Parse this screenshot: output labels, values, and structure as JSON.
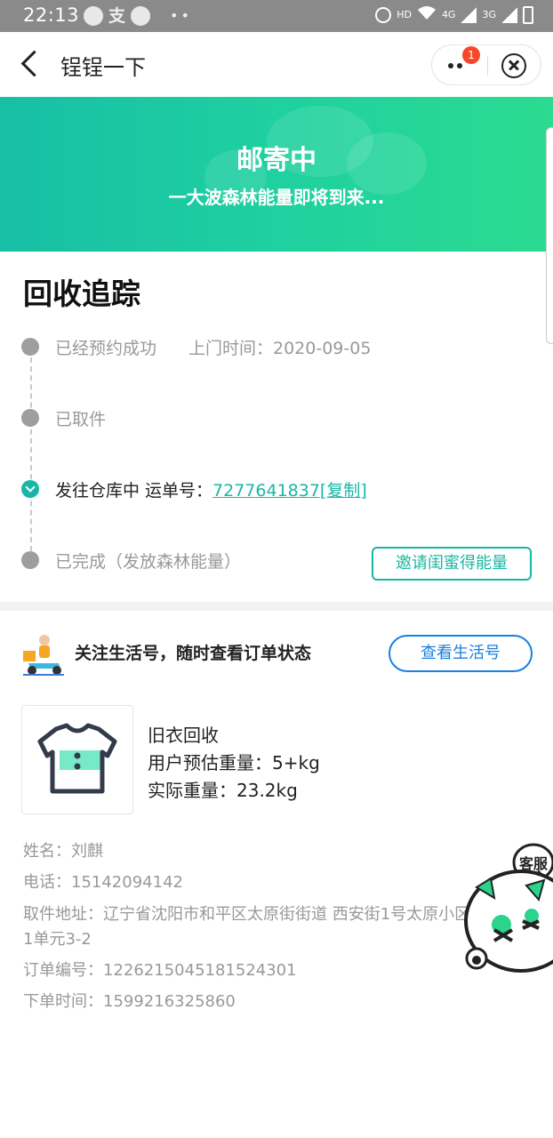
{
  "status_bar": {
    "time": "22:13",
    "app_icon_zhi": "支",
    "network": "HD",
    "sig1": "4G",
    "sig2": "3G"
  },
  "titlebar": {
    "title": "锃锃一下",
    "notification_count": "1",
    "icons": [
      "back-arrow-icon",
      "more-dots-icon",
      "close-circle-icon"
    ]
  },
  "banner": {
    "title": "邮寄中",
    "subtitle": "一大波森林能量即将到来..."
  },
  "tracking": {
    "title": "回收追踪",
    "steps": [
      {
        "label": "已经预约成功",
        "time": "上门时间：2020-09-05",
        "status": "done"
      },
      {
        "label": "已取件",
        "status": "done"
      },
      {
        "label": "发往仓库中 运单号：",
        "tracking_no": "7277641837[复制]",
        "status": "current"
      },
      {
        "label": "已完成（发放森林能量）",
        "status": "pending"
      }
    ],
    "invite_button": "邀请闺蜜得能量"
  },
  "follow": {
    "text": "关注生活号，随时查看订单状态",
    "button": "查看生活号"
  },
  "product": {
    "name": "旧衣回收",
    "estimate": "用户预估重量：5+kg",
    "actual": "实际重量：23.2kg"
  },
  "info": {
    "name": "姓名：刘麒",
    "phone": "电话：15142094142",
    "address_line1": "取件地址：辽宁省沈阳市和平区太原街街道 西安街1号太原小区",
    "address_line2": "1单元3-2",
    "order_no": "订单编号：1226215045181524301",
    "order_time": "下单时间：1599216325860"
  },
  "customer_service": {
    "label": "客服"
  },
  "colors": {
    "accent": "#18b7a5",
    "link_blue": "#1a7fe0",
    "badge_red": "#f5482b"
  }
}
